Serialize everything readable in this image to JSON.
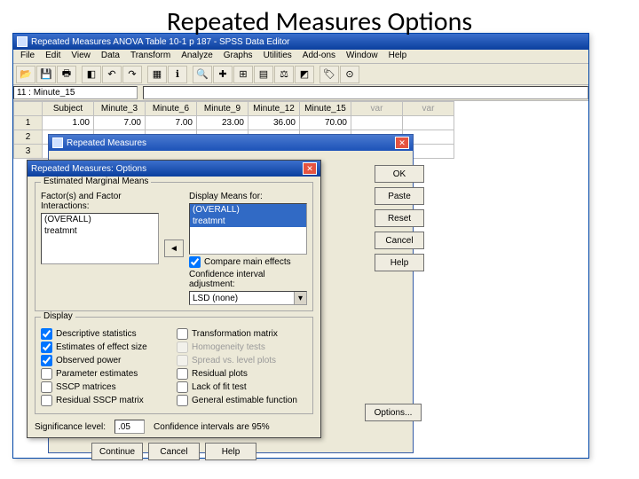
{
  "slide_title": "Repeated Measures Options",
  "spss": {
    "title": "Repeated Measures ANOVA Table 10-1 p 187 - SPSS Data Editor",
    "menu": [
      "File",
      "Edit",
      "View",
      "Data",
      "Transform",
      "Analyze",
      "Graphs",
      "Utilities",
      "Add-ons",
      "Window",
      "Help"
    ],
    "cellref": "11 : Minute_15",
    "cols": [
      "Subject",
      "Minute_3",
      "Minute_6",
      "Minute_9",
      "Minute_12",
      "Minute_15",
      "var",
      "var"
    ],
    "rows": [
      {
        "n": "1",
        "c": [
          "1.00",
          "7.00",
          "7.00",
          "23.00",
          "36.00",
          "70.00",
          "",
          ""
        ]
      },
      {
        "n": "2",
        "c": [
          "",
          "",
          "",
          "",
          "",
          "",
          "",
          ""
        ]
      },
      {
        "n": "3",
        "c": [
          "",
          "",
          "",
          "",
          "",
          "",
          "",
          ""
        ]
      }
    ]
  },
  "rm_dialog": {
    "title": "Repeated Measures"
  },
  "side_buttons": [
    "OK",
    "Paste",
    "Reset",
    "Cancel",
    "Help"
  ],
  "options_button": "Options...",
  "options": {
    "title": "Repeated Measures: Options",
    "emm_group": "Estimated Marginal Means",
    "factors_label": "Factor(s) and Factor Interactions:",
    "display_label": "Display Means for:",
    "f_items": [
      "(OVERALL)",
      "treatmnt"
    ],
    "d_items": [
      "(OVERALL)",
      "treatmnt"
    ],
    "compare": "Compare main effects",
    "ci_adj": "Confidence interval adjustment:",
    "ci_combo": "LSD (none)",
    "display_group": "Display",
    "left_checks": [
      "Descriptive statistics",
      "Estimates of effect size",
      "Observed power",
      "Parameter estimates",
      "SSCP matrices",
      "Residual SSCP matrix"
    ],
    "right_checks": [
      "Transformation matrix",
      "Homogeneity tests",
      "Spread vs. level plots",
      "Residual plots",
      "Lack of fit test",
      "General estimable function"
    ],
    "sig_label": "Significance level:",
    "sig_val": ".05",
    "ci_text": "Confidence intervals are 95%",
    "buttons": [
      "Continue",
      "Cancel",
      "Help"
    ]
  }
}
